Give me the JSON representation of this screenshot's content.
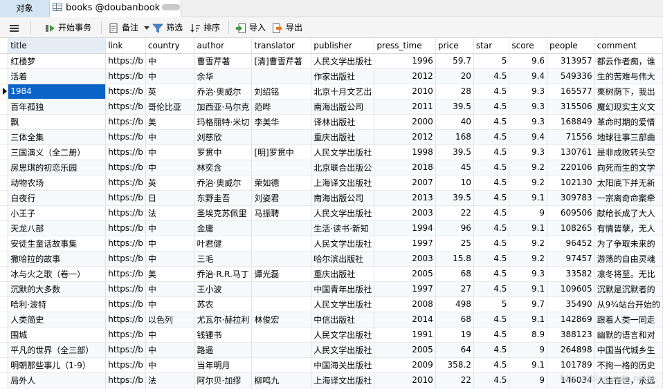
{
  "tabs": {
    "objects": "对象",
    "table": "books @doubanbook"
  },
  "toolbar": {
    "begin_transaction": "开始事务",
    "memo": "备注",
    "filter": "筛选",
    "sort": "排序",
    "import": "导入",
    "export": "导出"
  },
  "columns": [
    "title",
    "link",
    "country",
    "author",
    "translator",
    "publisher",
    "press_time",
    "price",
    "star",
    "score",
    "people",
    "comment"
  ],
  "rows": [
    [
      "红楼梦",
      "https://b",
      "中",
      "曹雪芹著",
      "[清]曹雪芹著",
      "人民文学出版社",
      "1996",
      "59.7",
      "5",
      "9.6",
      "313957",
      "都云作者痴，谁"
    ],
    [
      "活着",
      "https://b",
      "中",
      "余华",
      "",
      "作家出版社",
      "2012",
      "20",
      "4.5",
      "9.4",
      "549336",
      "生的苦难与伟大"
    ],
    [
      "1984",
      "https://b",
      "英",
      "乔治·奥威尔",
      "刘绍铭",
      "北京十月文艺出",
      "2010",
      "28",
      "4.5",
      "9.3",
      "165577",
      "栗树荫下，我出"
    ],
    [
      "百年孤独",
      "https://b",
      "哥伦比亚",
      "加西亚·马尔克",
      "范晔",
      "南海出版公司",
      "2011",
      "39.5",
      "4.5",
      "9.3",
      "315506",
      "魔幻现实主义文"
    ],
    [
      "飘",
      "https://b",
      "美",
      "玛格丽特·米切",
      "李美华",
      "译林出版社",
      "2000",
      "40",
      "4.5",
      "9.3",
      "168849",
      "革命时期的爱情"
    ],
    [
      "三体全集",
      "https://b",
      "中",
      "刘慈欣",
      "",
      "重庆出版社",
      "2012",
      "168",
      "4.5",
      "9.4",
      "71556",
      "地球往事三部曲"
    ],
    [
      "三国演义（全二册）",
      "https://b",
      "中",
      "罗贯中",
      "[明]罗贯中",
      "人民文学出版社",
      "1998",
      "39.5",
      "4.5",
      "9.3",
      "130761",
      "是非成败转头空"
    ],
    [
      "房思琪的初恋乐园",
      "https://b",
      "中",
      "林奕含",
      "",
      "北京联合出版公",
      "2018",
      "45",
      "4.5",
      "9.2",
      "220106",
      "向死而生的文学"
    ],
    [
      "动物农场",
      "https://b",
      "英",
      "乔治·奥威尔",
      "荣如德",
      "上海译文出版社",
      "2007",
      "10",
      "4.5",
      "9.2",
      "102130",
      "太阳底下并无新"
    ],
    [
      "白夜行",
      "https://b",
      "日",
      "东野圭吾",
      "刘姿君",
      "南海出版公司",
      "2013",
      "39.5",
      "4.5",
      "9.1",
      "309783",
      "一宗离奇命案牵"
    ],
    [
      "小王子",
      "https://b",
      "法",
      "圣埃克苏佩里",
      "马振聘",
      "人民文学出版社",
      "2003",
      "22",
      "4.5",
      "9",
      "609506",
      "献给长成了大人"
    ],
    [
      "天龙八部",
      "https://b",
      "中",
      "金庸",
      "",
      "生活·读书·新知",
      "1994",
      "96",
      "4.5",
      "9.1",
      "108265",
      "有情皆孽，无人"
    ],
    [
      "安徒生童话故事集",
      "https://b",
      "中",
      "叶君健",
      "",
      "人民文学出版社",
      "1997",
      "25",
      "4.5",
      "9.2",
      "96452",
      "为了争取未来的"
    ],
    [
      "撒哈拉的故事",
      "https://b",
      "中",
      "三毛",
      "",
      "哈尔滨出版社",
      "2003",
      "15.8",
      "4.5",
      "9.2",
      "97457",
      "游荡的自由灵魂"
    ],
    [
      "冰与火之歌（卷一）",
      "https://b",
      "美",
      "乔治·R.R.马丁",
      "谭光磊",
      "重庆出版社",
      "2005",
      "68",
      "4.5",
      "9.3",
      "33582",
      "凛冬将至。无比"
    ],
    [
      "沉默的大多数",
      "https://b",
      "中",
      "王小波",
      "",
      "中国青年出版社",
      "1997",
      "27",
      "4.5",
      "9.1",
      "109605",
      "沉默是沉默者的"
    ],
    [
      "哈利·波特",
      "https://b",
      "中",
      "苏农",
      "",
      "人民文学出版社",
      "2008",
      "498",
      "5",
      "9.7",
      "35490",
      "从9¾站台开始的"
    ],
    [
      "人类简史",
      "https://b",
      "以色列",
      "尤瓦尔·赫拉利",
      "林俊宏",
      "中信出版社",
      "2014",
      "68",
      "4.5",
      "9.1",
      "142869",
      "跟着人类一同走"
    ],
    [
      "围城",
      "https://b",
      "中",
      "钱锺书",
      "",
      "人民文学出版社",
      "1991",
      "19",
      "4.5",
      "8.9",
      "388123",
      "幽默的语言和对"
    ],
    [
      "平凡的世界（全三部）",
      "https://b",
      "中",
      "路遥",
      "",
      "人民文学出版社",
      "2005",
      "64",
      "4.5",
      "9",
      "264898",
      "中国当代城乡生"
    ],
    [
      "明朝那些事儿（1-9）",
      "https://b",
      "中",
      "当年明月",
      "",
      "中国海关出版社",
      "2009",
      "358.2",
      "4.5",
      "9.1",
      "101789",
      "不拘一格的历史"
    ],
    [
      "局外人",
      "https://b",
      "法",
      "阿尔贝·加缪",
      "柳鸣九",
      "上海译文出版社",
      "2010",
      "22",
      "4.5",
      "9",
      "146034",
      "人生在世，永远"
    ]
  ],
  "watermark": "https://blog.csdn.net/..."
}
